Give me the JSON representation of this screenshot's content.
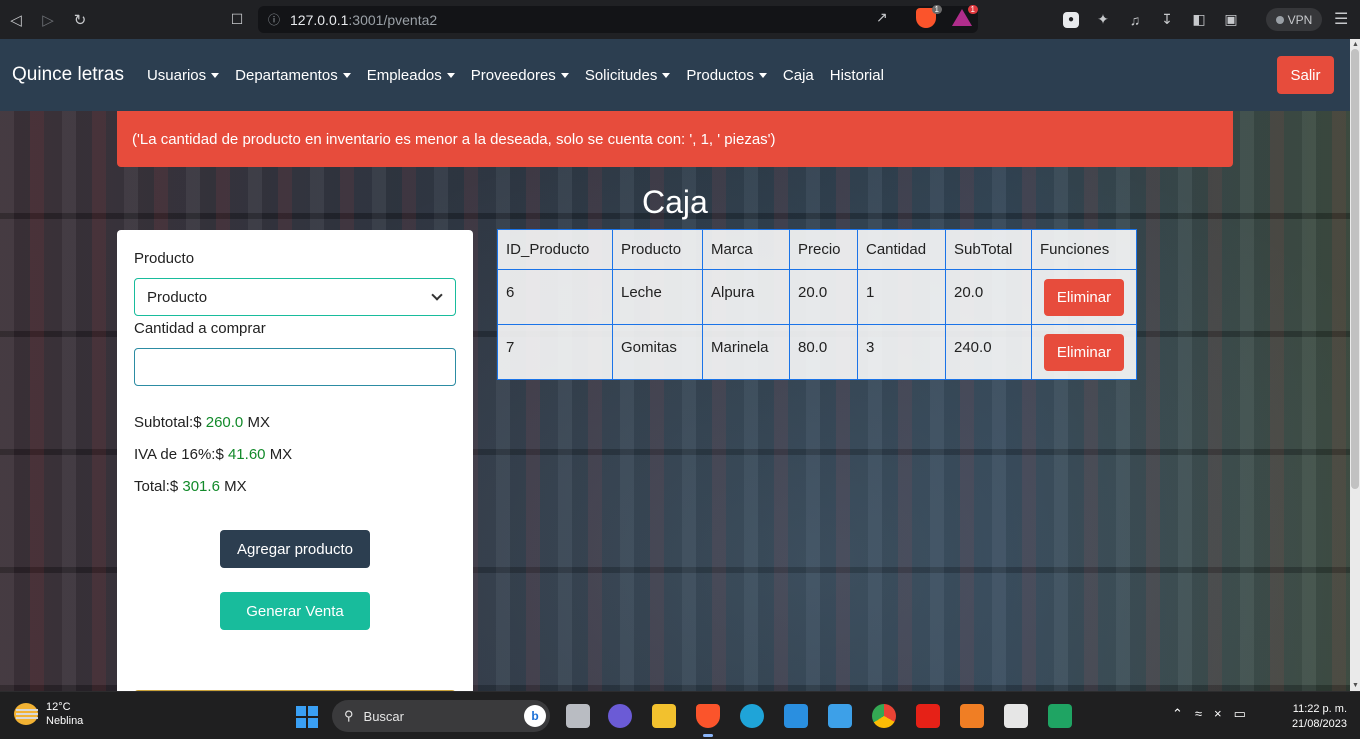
{
  "browser": {
    "url_host": "127.0.0.1",
    "url_rest": ":3001/pventa2",
    "shield_badge": "1",
    "rewards_badge": "1",
    "vpn_label": "VPN"
  },
  "navbar": {
    "brand": "Quince letras",
    "items": [
      {
        "label": "Usuarios",
        "dropdown": true
      },
      {
        "label": "Departamentos",
        "dropdown": true
      },
      {
        "label": "Empleados",
        "dropdown": true
      },
      {
        "label": "Proveedores",
        "dropdown": true
      },
      {
        "label": "Solicitudes",
        "dropdown": true
      },
      {
        "label": "Productos",
        "dropdown": true
      },
      {
        "label": "Caja",
        "dropdown": false
      },
      {
        "label": "Historial",
        "dropdown": false
      }
    ],
    "logout": "Salir"
  },
  "alert": {
    "message": "('La cantidad de producto en inventario es menor a la deseada, solo se cuenta con: ', 1, ' piezas')"
  },
  "page": {
    "title": "Caja"
  },
  "form": {
    "product_label": "Producto",
    "product_selected": "Producto",
    "quantity_label": "Cantidad a comprar",
    "quantity_value": "",
    "subtotal_label": "Subtotal:$",
    "subtotal_value": "260.0",
    "iva_label": "IVA de 16%:$",
    "iva_value": "41.60",
    "total_label": "Total:$",
    "total_value": "301.6",
    "currency": "MX",
    "add_button": "Agregar producto",
    "sale_button": "Generar Venta"
  },
  "table": {
    "headers": [
      "ID_Producto",
      "Producto",
      "Marca",
      "Precio",
      "Cantidad",
      "SubTotal",
      "Funciones"
    ],
    "rows": [
      {
        "id": "6",
        "product": "Leche",
        "brand": "Alpura",
        "price": "20.0",
        "qty": "1",
        "subtotal": "20.0",
        "action": "Eliminar"
      },
      {
        "id": "7",
        "product": "Gomitas",
        "brand": "Marinela",
        "price": "80.0",
        "qty": "3",
        "subtotal": "240.0",
        "action": "Eliminar"
      }
    ]
  },
  "taskbar": {
    "temp": "12°C",
    "weather": "Neblina",
    "search_placeholder": "Buscar",
    "time": "11:22 p. m.",
    "date": "21/08/2023"
  }
}
